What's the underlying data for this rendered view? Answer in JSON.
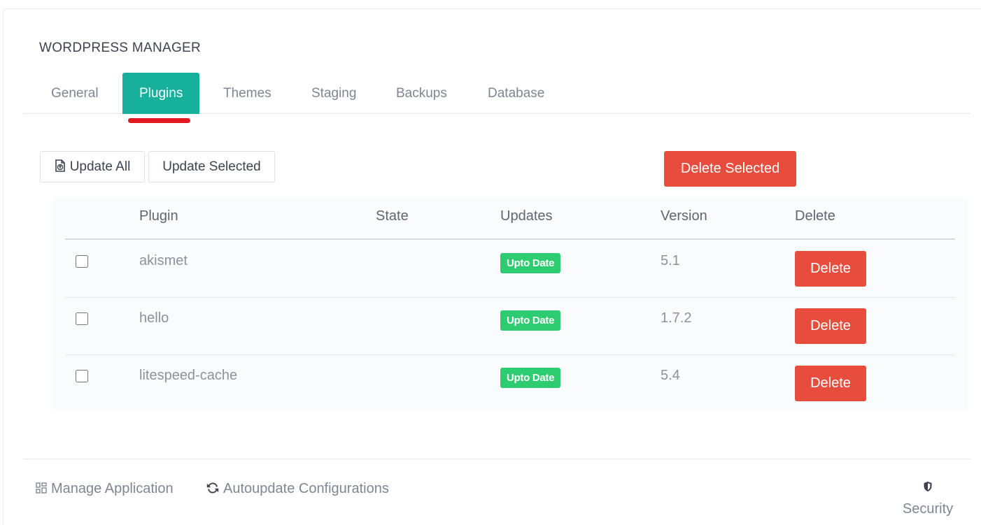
{
  "page": {
    "title": "WORDPRESS MANAGER"
  },
  "tabs": [
    {
      "label": "General"
    },
    {
      "label": "Plugins",
      "active": true
    },
    {
      "label": "Themes"
    },
    {
      "label": "Staging"
    },
    {
      "label": "Backups"
    },
    {
      "label": "Database"
    }
  ],
  "toolbar": {
    "update_all": "Update All",
    "update_selected": "Update Selected",
    "delete_selected": "Delete Selected"
  },
  "table": {
    "headers": {
      "plugin": "Plugin",
      "state": "State",
      "updates": "Updates",
      "version": "Version",
      "delete": "Delete"
    },
    "rows": [
      {
        "name": "akismet",
        "state": "",
        "status": "Upto Date",
        "version": "5.1",
        "action": "Delete"
      },
      {
        "name": "hello",
        "state": "",
        "status": "Upto Date",
        "version": "1.7.2",
        "action": "Delete"
      },
      {
        "name": "litespeed-cache",
        "state": "",
        "status": "Upto Date",
        "version": "5.4",
        "action": "Delete"
      }
    ]
  },
  "footer": {
    "manage_application": "Manage Application",
    "autoupdate": "Autoupdate Configurations",
    "security": "Security"
  },
  "colors": {
    "accent": "#17b09d",
    "danger": "#e74c3c",
    "success": "#2ecc71",
    "highlight": "#e41a21"
  },
  "icons": {
    "update_all": "file-upload-icon",
    "manage_application": "grid-icon",
    "autoupdate": "refresh-icon",
    "security": "shield-icon"
  }
}
